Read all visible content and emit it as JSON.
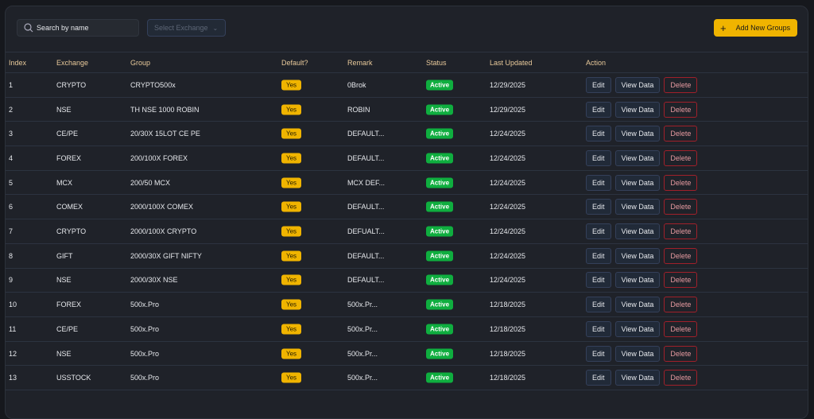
{
  "toolbar": {
    "search_placeholder": "Search by name",
    "select_placeholder": "Select Exchange",
    "add_label": "Add New Groups"
  },
  "columns": [
    "Index",
    "Exchange",
    "Group",
    "Default?",
    "Remark",
    "Status",
    "Last Updated",
    "Action"
  ],
  "actions": {
    "edit": "Edit",
    "view": "View Data",
    "delete": "Delete"
  },
  "rows": [
    {
      "index": "1",
      "exchange": "CRYPTO",
      "group": "CRYPTO500x",
      "default": "Yes",
      "remark": "0Brok",
      "status": "Active",
      "updated": "12/29/2025"
    },
    {
      "index": "2",
      "exchange": "NSE",
      "group": "TH NSE 1000 ROBIN",
      "default": "Yes",
      "remark": "ROBIN",
      "status": "Active",
      "updated": "12/29/2025"
    },
    {
      "index": "3",
      "exchange": "CE/PE",
      "group": "20/30X 15LOT CE PE",
      "default": "Yes",
      "remark": "DEFAULT...",
      "status": "Active",
      "updated": "12/24/2025"
    },
    {
      "index": "4",
      "exchange": "FOREX",
      "group": "200/100X FOREX",
      "default": "Yes",
      "remark": "DEFAULT...",
      "status": "Active",
      "updated": "12/24/2025"
    },
    {
      "index": "5",
      "exchange": "MCX",
      "group": "200/50 MCX",
      "default": "Yes",
      "remark": "MCX DEF...",
      "status": "Active",
      "updated": "12/24/2025"
    },
    {
      "index": "6",
      "exchange": "COMEX",
      "group": "2000/100X COMEX",
      "default": "Yes",
      "remark": "DEFAULT...",
      "status": "Active",
      "updated": "12/24/2025"
    },
    {
      "index": "7",
      "exchange": "CRYPTO",
      "group": "2000/100X CRYPTO",
      "default": "Yes",
      "remark": "DEFUALT...",
      "status": "Active",
      "updated": "12/24/2025"
    },
    {
      "index": "8",
      "exchange": "GIFT",
      "group": "2000/30X GIFT NIFTY",
      "default": "Yes",
      "remark": "DEFAULT...",
      "status": "Active",
      "updated": "12/24/2025"
    },
    {
      "index": "9",
      "exchange": "NSE",
      "group": "2000/30X NSE",
      "default": "Yes",
      "remark": "DEFAULT...",
      "status": "Active",
      "updated": "12/24/2025"
    },
    {
      "index": "10",
      "exchange": "FOREX",
      "group": "500x.Pro",
      "default": "Yes",
      "remark": "500x.Pr...",
      "status": "Active",
      "updated": "12/18/2025"
    },
    {
      "index": "11",
      "exchange": "CE/PE",
      "group": "500x.Pro",
      "default": "Yes",
      "remark": "500x.Pr...",
      "status": "Active",
      "updated": "12/18/2025"
    },
    {
      "index": "12",
      "exchange": "NSE",
      "group": "500x.Pro",
      "default": "Yes",
      "remark": "500x.Pr...",
      "status": "Active",
      "updated": "12/18/2025"
    },
    {
      "index": "13",
      "exchange": "USSTOCK",
      "group": "500x.Pro",
      "default": "Yes",
      "remark": "500x.Pr...",
      "status": "Active",
      "updated": "12/18/2025"
    }
  ]
}
